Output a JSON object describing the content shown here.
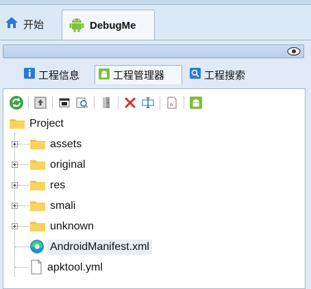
{
  "tabs": {
    "start": {
      "label": "开始",
      "icon": "home-icon"
    },
    "debug": {
      "label": "DebugMe",
      "icon": "android-icon"
    }
  },
  "search": {
    "icon": "eye-icon"
  },
  "subtabs": [
    {
      "label": "工程信息",
      "icon": "info-icon"
    },
    {
      "label": "工程管理器",
      "icon": "android-icon"
    },
    {
      "label": "工程搜索",
      "icon": "search-icon"
    }
  ],
  "toolbar": [
    {
      "name": "refresh",
      "icon": "refresh-icon"
    },
    {
      "name": "upload",
      "icon": "upload-icon"
    },
    {
      "name": "window",
      "icon": "window-icon"
    },
    {
      "name": "find",
      "icon": "find-file-icon"
    },
    {
      "name": "open",
      "icon": "door-icon"
    },
    {
      "name": "delete",
      "icon": "delete-icon"
    },
    {
      "name": "rename",
      "icon": "rename-icon"
    },
    {
      "name": "text-file",
      "icon": "text-file-icon"
    },
    {
      "name": "build",
      "icon": "android-icon"
    }
  ],
  "tree": {
    "root": "Project",
    "children": [
      {
        "label": "assets",
        "type": "folder"
      },
      {
        "label": "original",
        "type": "folder"
      },
      {
        "label": "res",
        "type": "folder"
      },
      {
        "label": "smali",
        "type": "folder"
      },
      {
        "label": "unknown",
        "type": "folder"
      },
      {
        "label": "AndroidManifest.xml",
        "type": "file-edge",
        "selected": true
      },
      {
        "label": "apktool.yml",
        "type": "file"
      }
    ]
  },
  "colors": {
    "folder": "#f5c344",
    "android": "#7cc13a",
    "delete": "#d92b2b",
    "accent": "#2a7ad6"
  }
}
